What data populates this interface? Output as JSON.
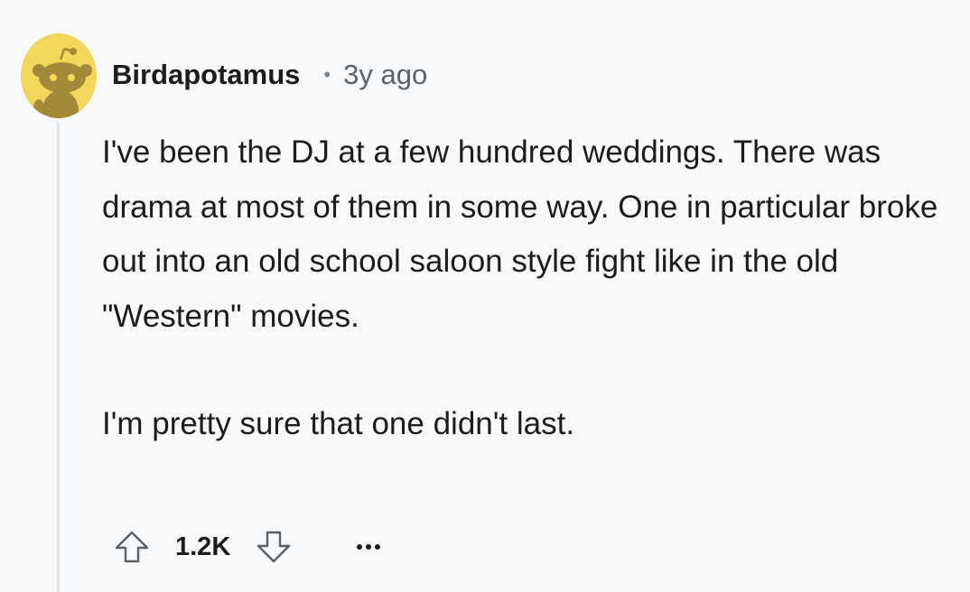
{
  "comment": {
    "author": "Birdapotamus",
    "separator": "•",
    "timestamp": "3y ago",
    "paragraphs": [
      "I've been the DJ at a few hundred weddings. There was drama at most of them in some way. One in particular broke out into an old school saloon style fight like in the old \"Western\" movies.",
      "I'm pretty sure that one didn't last."
    ],
    "score": "1.2K"
  },
  "icons": {
    "avatar": "snoo-avatar-icon",
    "upvote": "upvote-arrow-icon",
    "downvote": "downvote-arrow-icon",
    "more": "more-options-icon"
  },
  "colors": {
    "avatar_bg": "#f2d75a",
    "snoo": "#a38a38",
    "text": "#1c1c1c",
    "muted": "#5c6166",
    "thread_line": "#dfe4e9"
  }
}
